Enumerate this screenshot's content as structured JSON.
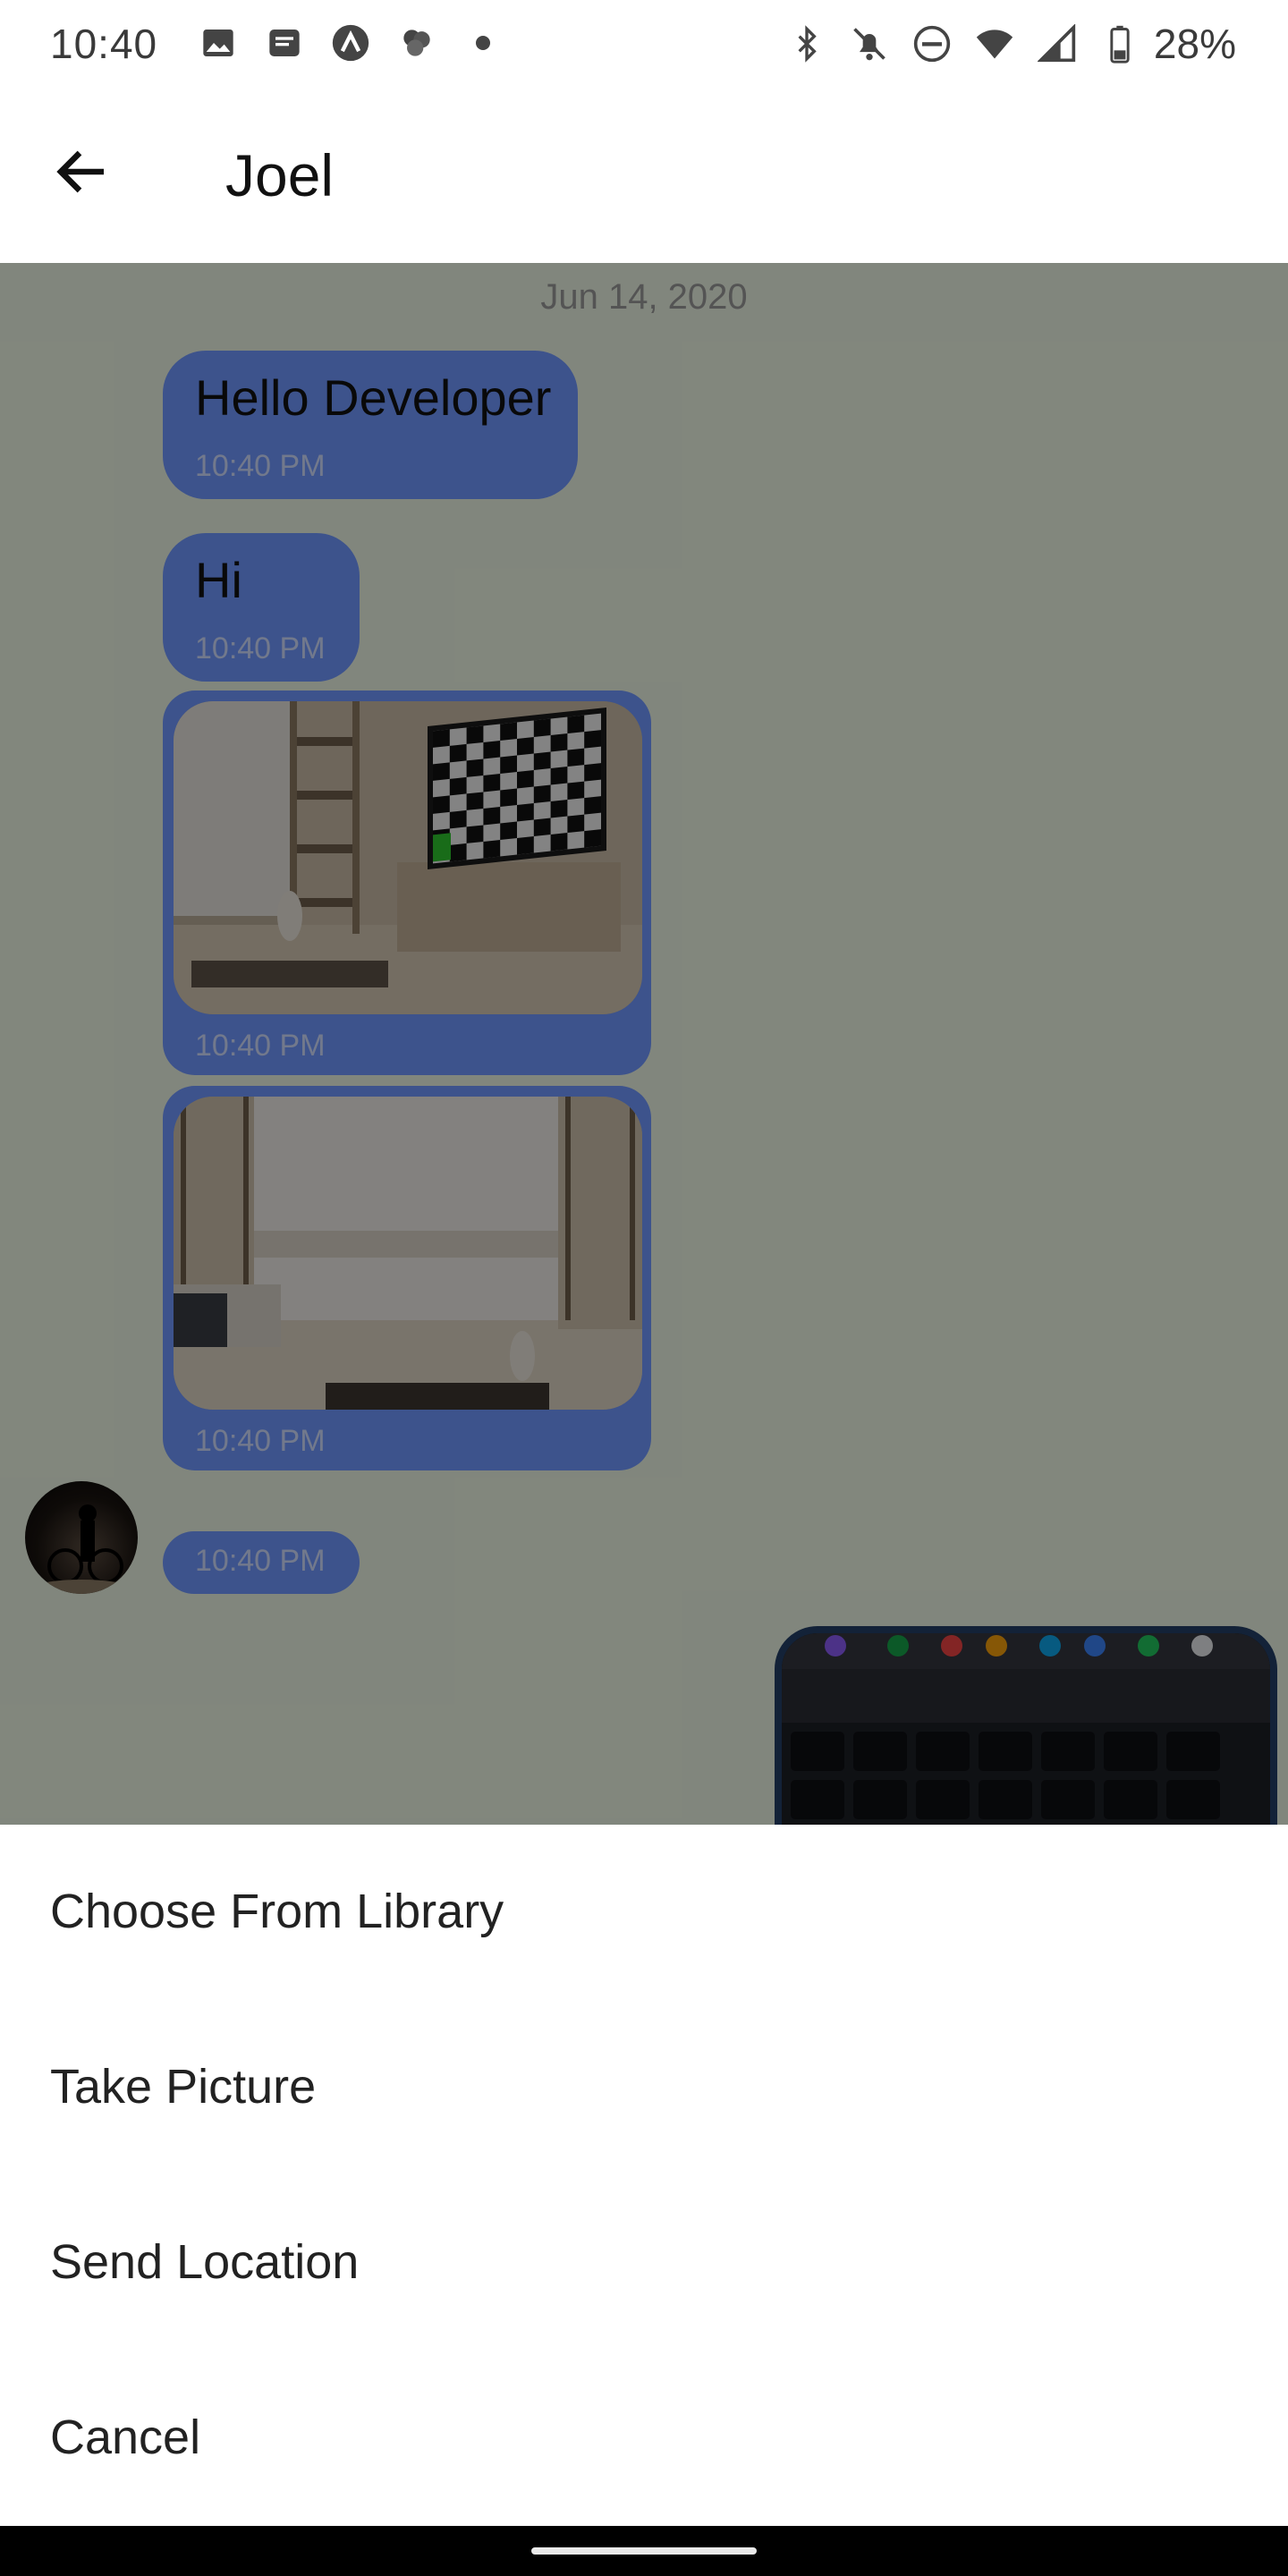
{
  "status_bar": {
    "time": "10:40",
    "battery_percent": "28%",
    "left_icons": [
      "photo-icon",
      "message-icon",
      "arc-app-icon",
      "pinwheel-icon",
      "dot-icon"
    ],
    "right_icons": [
      "bluetooth-icon",
      "bell-off-icon",
      "do-not-disturb-icon",
      "wifi-icon",
      "cell-signal-icon",
      "battery-icon"
    ]
  },
  "app_bar": {
    "title": "Joel",
    "back_icon": "arrow-left-icon"
  },
  "chat": {
    "date_label": "Jun 14, 2020",
    "messages": [
      {
        "type": "text",
        "text": "Hello Developer",
        "time": "10:40 PM"
      },
      {
        "type": "text",
        "text": "Hi",
        "time": "10:40 PM"
      },
      {
        "type": "image",
        "description_icon": "image-living-room-tv",
        "time": "10:40 PM"
      },
      {
        "type": "image",
        "description_icon": "image-living-room-window",
        "time": "10:40 PM"
      },
      {
        "type": "empty",
        "time": "10:40 PM"
      },
      {
        "type": "image-outgoing",
        "description_icon": "image-laptop-keyboard"
      }
    ],
    "colors": {
      "incoming_bubble": "#6f97ff",
      "chat_background": "#ecf5e4",
      "scrim": "rgba(0,0,0,0.45)"
    }
  },
  "action_sheet": {
    "items": [
      "Choose From Library",
      "Take Picture",
      "Send Location",
      "Cancel"
    ]
  }
}
